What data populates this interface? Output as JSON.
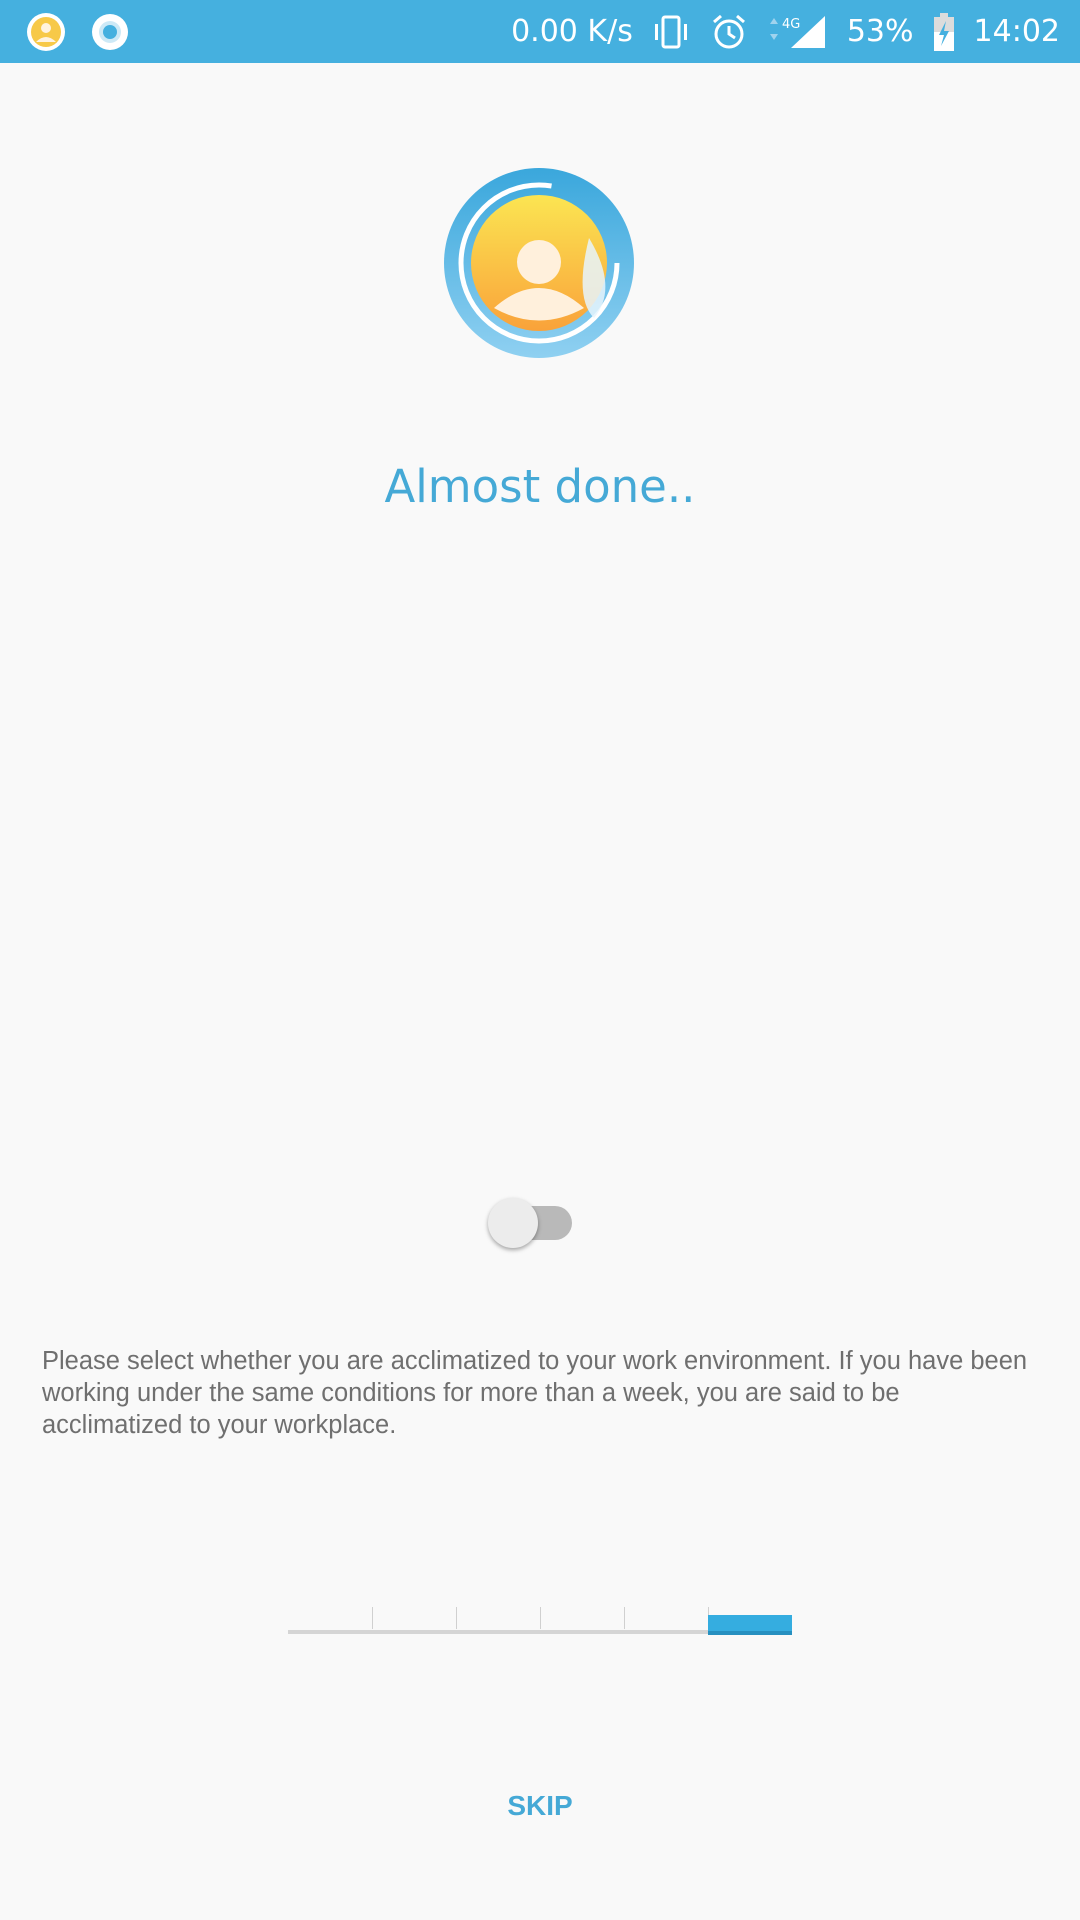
{
  "status_bar": {
    "left_icons": [
      "app-avatar-notification-icon",
      "record-notification-icon"
    ],
    "network_speed": "0.00 K/s",
    "network_type": "4G",
    "battery_percent": "53%",
    "time": "14:02",
    "icons": [
      "vibrate-icon",
      "alarm-icon",
      "data-arrows-icon",
      "signal-icon",
      "battery-charging-icon"
    ],
    "background": "#45b0df"
  },
  "main": {
    "title": "Almost done..",
    "toggle": {
      "state": "off"
    },
    "description": "Please select whether you are acclimatized to your work environment. If you have been working under the same conditions for more than a week, you are said to be acclimatized to your workplace.",
    "steps": {
      "total": 6,
      "current": 6
    },
    "skip_label": "SKIP"
  },
  "colors": {
    "accent": "#45a9d6",
    "background": "#f9f9f9",
    "text_secondary": "#6f6f6f",
    "step_active": "#35ade0"
  }
}
